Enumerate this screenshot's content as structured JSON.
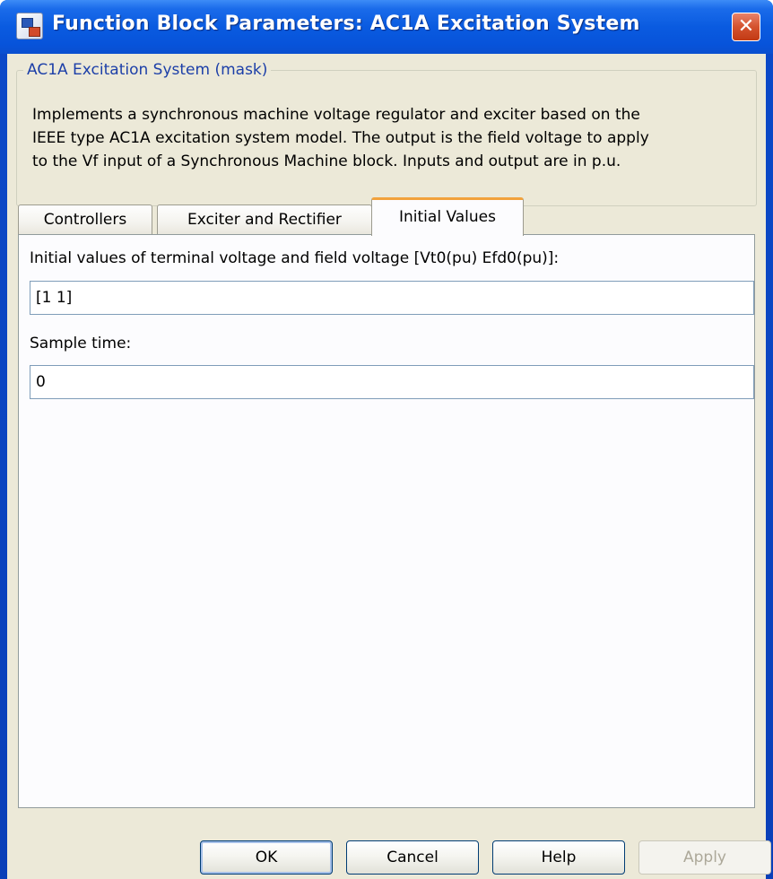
{
  "window": {
    "title": "Function Block Parameters: AC1A Excitation System",
    "close_glyph": "✕"
  },
  "mask": {
    "group_title": "AC1A Excitation System (mask)",
    "description_lines": [
      "Implements a synchronous machine voltage regulator and exciter based on the",
      "IEEE type AC1A excitation system model. The output is the field voltage to apply",
      "to the Vf input of a Synchronous Machine block. Inputs and output are in p.u."
    ]
  },
  "tabs": [
    {
      "label": "Controllers",
      "active": false
    },
    {
      "label": "Exciter and Rectifier",
      "active": false
    },
    {
      "label": "Initial Values",
      "active": true
    }
  ],
  "fields": {
    "initial_values": {
      "label": "Initial values of terminal voltage and field voltage [Vt0(pu) Efd0(pu)]:",
      "value": "[1 1]"
    },
    "sample_time": {
      "label": "Sample time:",
      "value": "0"
    }
  },
  "buttons": {
    "ok": "OK",
    "cancel": "Cancel",
    "help": "Help",
    "apply": "Apply"
  },
  "colors": {
    "titlebar": "#0a5be0",
    "active_tab_accent": "#f2a23c",
    "group_title_text": "#1c3fa8",
    "dialog_background": "#ece9d8"
  },
  "icons": {
    "window": "simulink-block-icon",
    "close": "close-icon"
  }
}
